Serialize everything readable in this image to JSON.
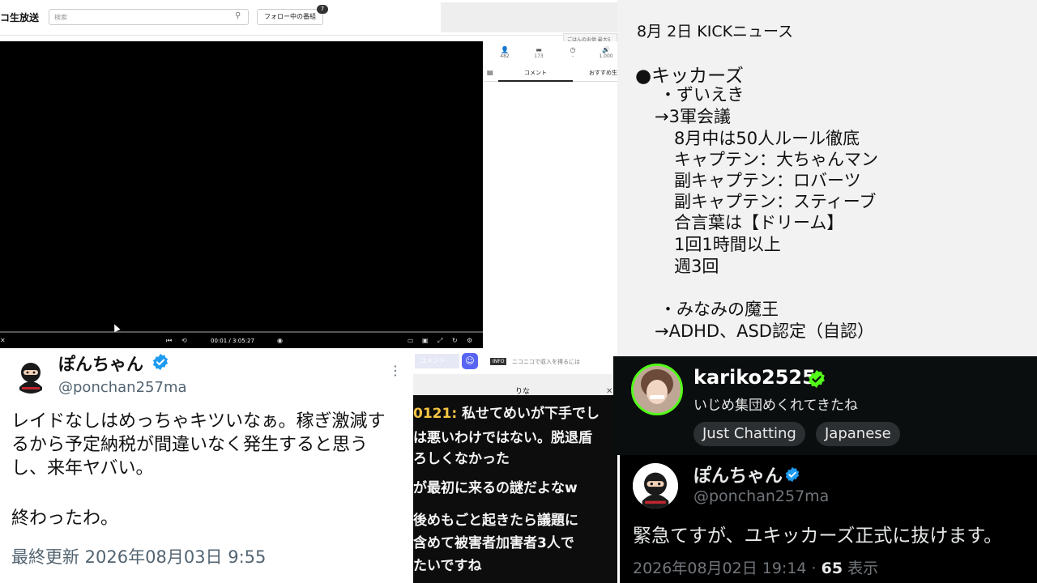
{
  "nico": {
    "logo": "コ生放送",
    "search_placeholder": "検索",
    "follow_button": "フォロー中の番組",
    "follow_badge": "7",
    "tooltip": "ごはんのお供 最大5",
    "time": "00:01 / 3:05:27",
    "stats": [
      {
        "icon": "person-icon",
        "value": "482"
      },
      {
        "icon": "comment-icon",
        "value": "173"
      },
      {
        "icon": "clock-icon",
        "value": "-"
      },
      {
        "icon": "ad-icon",
        "value": "1,000"
      }
    ],
    "tab_comment": "コメント",
    "tab_recommend": "おすすめ生"
  },
  "notes": {
    "title": "8月 2日 KICKニュース",
    "lines": [
      "●キッカーズ",
      "・ずいえき",
      "→3軍会議",
      "8月中は50人ルール徹底",
      "キャプテン：大ちゃんマン",
      "副キャプテン：ロバーツ",
      "副キャプテン：スティーブ",
      "合言葉は【ドリーム】",
      "1回1時間以上",
      "週3回",
      "・みなみの魔王",
      "→ADHD、ASD認定（自認）"
    ]
  },
  "tweet1": {
    "name": "ぽんちゃん",
    "handle": "@ponchan257ma",
    "body": "レイドなしはめっちゃキツいなぁ。稼ぎ激減するから予定納税が間違いなく発生すると思うし、来年ヤバい。",
    "body2": "終わったわ。",
    "updated": "最終更新 2026年08月03日 9:55",
    "verified_color": "#1d9bf0"
  },
  "chat": {
    "input_placeholder": "コメント",
    "info_badge": "INFO",
    "info_text": "ニコニコで収入を得るには",
    "rina": "りな",
    "user_prefix": "0121:",
    "lines": [
      " 私せてめいが下手でし",
      "は悪いわけではない。脱退盾",
      "ろしくなかった",
      "が最初に来るの謎だよなw",
      "後めもごと起きたら議題に",
      "含めて被害者加害者3人で",
      "たいですね"
    ]
  },
  "kick": {
    "name": "kariko2525",
    "title": "いじめ集団めくれてきたね",
    "tags": [
      "Just Chatting",
      "Japanese"
    ],
    "accent": "#53fc18"
  },
  "tweet2": {
    "name": "ぽんちゃん",
    "handle": "@ponchan257ma",
    "body": "緊急てすが、ユキッカーズ正式に抜けます。",
    "date": "2026年08月02日 19:14 · ",
    "views_num": "65",
    "views_label": " 表示"
  }
}
